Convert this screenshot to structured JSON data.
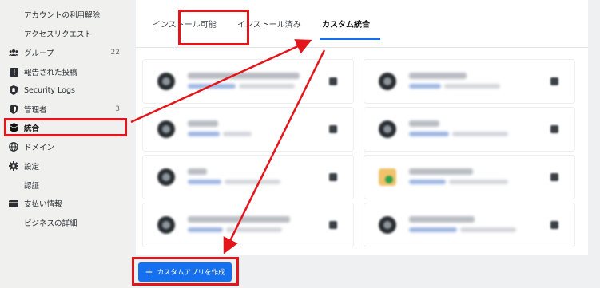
{
  "sidebar": {
    "items": [
      {
        "label": "アカウントの利用解除",
        "icon": "",
        "count": ""
      },
      {
        "label": "アクセスリクエスト",
        "icon": "",
        "count": ""
      },
      {
        "label": "グループ",
        "icon": "users-icon",
        "count": "22"
      },
      {
        "label": "報告された投稿",
        "icon": "flag-icon",
        "count": ""
      },
      {
        "label": "Security Logs",
        "icon": "shield-lock-icon",
        "count": ""
      },
      {
        "label": "管理者",
        "icon": "shield-icon",
        "count": "3"
      },
      {
        "label": "統合",
        "icon": "cube-icon",
        "count": ""
      },
      {
        "label": "ドメイン",
        "icon": "globe-icon",
        "count": ""
      },
      {
        "label": "設定",
        "icon": "gear-icon",
        "count": ""
      },
      {
        "label": "認証",
        "icon": "",
        "count": ""
      },
      {
        "label": "支払い情報",
        "icon": "credit-card-icon",
        "count": ""
      },
      {
        "label": "ビジネスの詳細",
        "icon": "",
        "count": ""
      }
    ]
  },
  "tabs": [
    {
      "label": "インストール可能"
    },
    {
      "label": "インストール済み"
    },
    {
      "label": "カスタム統合"
    }
  ],
  "footer": {
    "create_button_label": "カスタムアプリを作成",
    "create_button_icon": "plus-icon"
  },
  "colors": {
    "accent": "#1570ef",
    "highlight": "#e4141b"
  }
}
